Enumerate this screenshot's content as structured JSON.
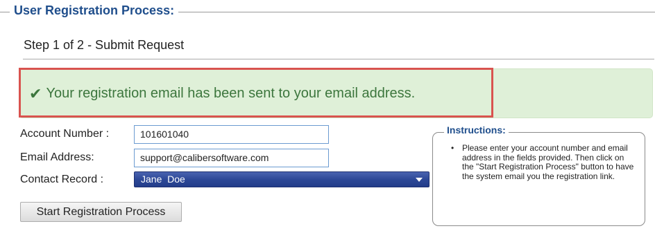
{
  "header": {
    "legend": "User Registration Process:",
    "step_title": "Step 1 of 2 - Submit Request"
  },
  "alert": {
    "icon": "checkmark-icon",
    "message": "Your registration email has been sent to your email address.",
    "colors": {
      "background": "#dff0d8",
      "text": "#3c763d",
      "highlight_border": "#d9534f"
    }
  },
  "form": {
    "account_number": {
      "label": "Account Number :",
      "value": "101601040"
    },
    "email": {
      "label": "Email Address:",
      "value": "support@calibersoftware.com"
    },
    "contact": {
      "label": "Contact Record :",
      "selected": "Jane  Doe"
    },
    "submit_label": "Start Registration Process"
  },
  "instructions": {
    "title": "Instructions:",
    "items": [
      "Please enter your account number and email address in the fields provided. Then click on the \"Start Registration Process\" button to have the system email you the registration link."
    ]
  }
}
